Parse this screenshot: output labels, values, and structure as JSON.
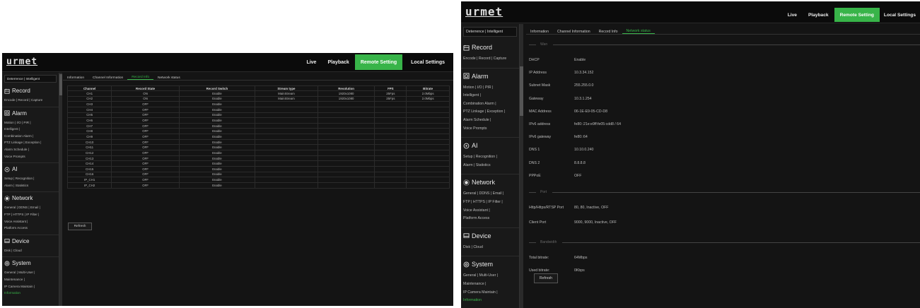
{
  "brand": "urmet",
  "nav": [
    "Live",
    "Playback",
    "Remote Setting",
    "Local Settings"
  ],
  "sidebar": {
    "top": "Deterrence | Intelligent",
    "sections": [
      {
        "title": "Record",
        "icon": "record-icon",
        "links": [
          "Encode | Record | Capture"
        ]
      },
      {
        "title": "Alarm",
        "icon": "alarm-icon",
        "links": [
          "Motion | I/O | PIR |",
          "Intelligent |",
          "Combination Alarm |",
          "PTZ Linkage | Exception |",
          "Alarm Schedule |",
          "Voice Prompts"
        ]
      },
      {
        "title": "AI",
        "icon": "ai-icon",
        "links": [
          "Setup | Recognition |",
          "Alarm | Statistics"
        ]
      },
      {
        "title": "Network",
        "icon": "network-icon",
        "links": [
          "General | DDNS | Email |",
          "FTP | HTTPS | IP Filter |",
          "Voice Assistant |",
          "Platform Access"
        ]
      },
      {
        "title": "Device",
        "icon": "device-icon",
        "links": [
          "Disk | Cloud"
        ]
      },
      {
        "title": "System",
        "icon": "system-icon",
        "links": [
          "General | Multi-User |",
          "Maintenance |",
          "IP Camera Maintain |"
        ],
        "current": "Information"
      }
    ]
  },
  "tabs": [
    "Information",
    "Channel Information",
    "Record Info",
    "Network status"
  ],
  "left": {
    "active_tab": 2,
    "columns": [
      "Channel",
      "Record State",
      "Record Switch",
      "Stream type",
      "Resolution",
      "FPS",
      "Bitrate"
    ],
    "rows": [
      [
        "CH1",
        "ON",
        "Enable",
        "MainStream",
        "1920x1080",
        "25Fps",
        "2.0Mbps"
      ],
      [
        "CH2",
        "ON",
        "Enable",
        "MainStream",
        "1920x1080",
        "25Fps",
        "2.0Mbps"
      ],
      [
        "CH3",
        "OFF",
        "Enable",
        "",
        "",
        "",
        ""
      ],
      [
        "CH4",
        "OFF",
        "Enable",
        "",
        "",
        "",
        ""
      ],
      [
        "CH5",
        "OFF",
        "Enable",
        "",
        "",
        "",
        ""
      ],
      [
        "CH6",
        "OFF",
        "Enable",
        "",
        "",
        "",
        ""
      ],
      [
        "CH7",
        "OFF",
        "Enable",
        "",
        "",
        "",
        ""
      ],
      [
        "CH8",
        "OFF",
        "Enable",
        "",
        "",
        "",
        ""
      ],
      [
        "CH9",
        "OFF",
        "Enable",
        "",
        "",
        "",
        ""
      ],
      [
        "CH10",
        "OFF",
        "Enable",
        "",
        "",
        "",
        ""
      ],
      [
        "CH11",
        "OFF",
        "Enable",
        "",
        "",
        "",
        ""
      ],
      [
        "CH12",
        "OFF",
        "Enable",
        "",
        "",
        "",
        ""
      ],
      [
        "CH13",
        "OFF",
        "Enable",
        "",
        "",
        "",
        ""
      ],
      [
        "CH14",
        "OFF",
        "Enable",
        "",
        "",
        "",
        ""
      ],
      [
        "CH15",
        "OFF",
        "Enable",
        "",
        "",
        "",
        ""
      ],
      [
        "CH16",
        "OFF",
        "Enable",
        "",
        "",
        "",
        ""
      ],
      [
        "IP_CH1",
        "OFF",
        "Enable",
        "",
        "",
        "",
        ""
      ],
      [
        "IP_CH2",
        "OFF",
        "Enable",
        "",
        "",
        "",
        ""
      ]
    ],
    "refresh": "Refresh"
  },
  "right": {
    "active_tab": 3,
    "groups": [
      {
        "title": "Wan",
        "items": [
          [
            "DHCP",
            "Enable"
          ],
          [
            "IP Address",
            "10.3.34.152"
          ],
          [
            "Subnet Mask",
            "255.255.0.0"
          ],
          [
            "Gateway",
            "10.3.1.254"
          ],
          [
            "MAC Address",
            "06-1E-E9-05-CD-D8"
          ],
          [
            "IPv6 address",
            "fe80::21e:e9ff:fe05:cdd8 / 64"
          ],
          [
            "IPv6 gateway",
            "fe80::64"
          ],
          [
            "DNS 1",
            "10.10.0.240"
          ],
          [
            "DNS 2",
            "8.8.8.8"
          ],
          [
            "PPPoE",
            "OFF"
          ]
        ]
      },
      {
        "title": "Port",
        "items": [
          [
            "Http/Https/RTSP Port",
            "80, 80, Inactive, OFF"
          ],
          [
            "Client Port",
            "9000, 9000, Inactive, OFF"
          ]
        ]
      },
      {
        "title": "Bandwidth",
        "items": [
          [
            "Total bitrate:",
            "64Mbps"
          ],
          [
            "Used bitrate:",
            "0Kbps"
          ]
        ]
      }
    ],
    "refresh": "Refresh"
  },
  "colors": {
    "accent": "#38b449",
    "background": "#141414"
  }
}
